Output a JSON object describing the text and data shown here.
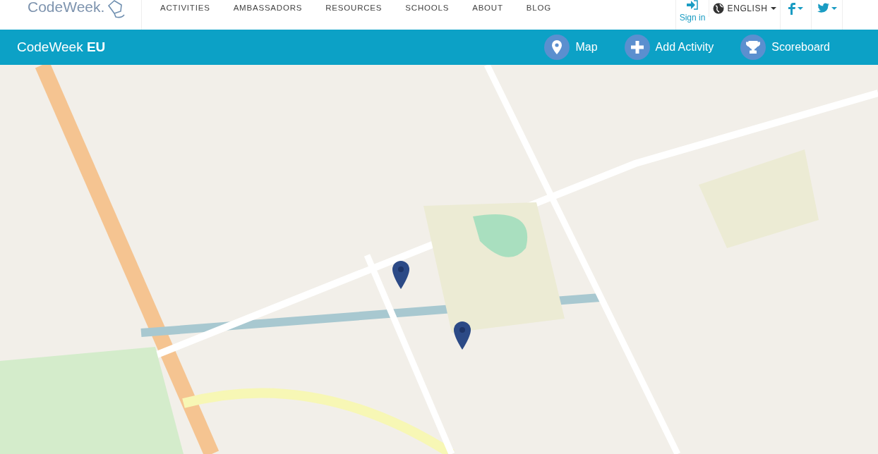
{
  "logo": {
    "text": "CodeWeek."
  },
  "nav": {
    "items": [
      {
        "label": "ACTIVITIES"
      },
      {
        "label": "AMBASSADORS"
      },
      {
        "label": "RESOURCES"
      },
      {
        "label": "SCHOOLS"
      },
      {
        "label": "ABOUT"
      },
      {
        "label": "BLOG"
      }
    ],
    "sign_in": "Sign in",
    "language": "ENGLISH"
  },
  "subbar": {
    "title_plain": "CodeWeek ",
    "title_bold": "EU",
    "actions": [
      {
        "kind": "map",
        "label": "Map"
      },
      {
        "kind": "add",
        "label": "Add Activity"
      },
      {
        "kind": "trophy",
        "label": "Scoreboard"
      }
    ]
  }
}
